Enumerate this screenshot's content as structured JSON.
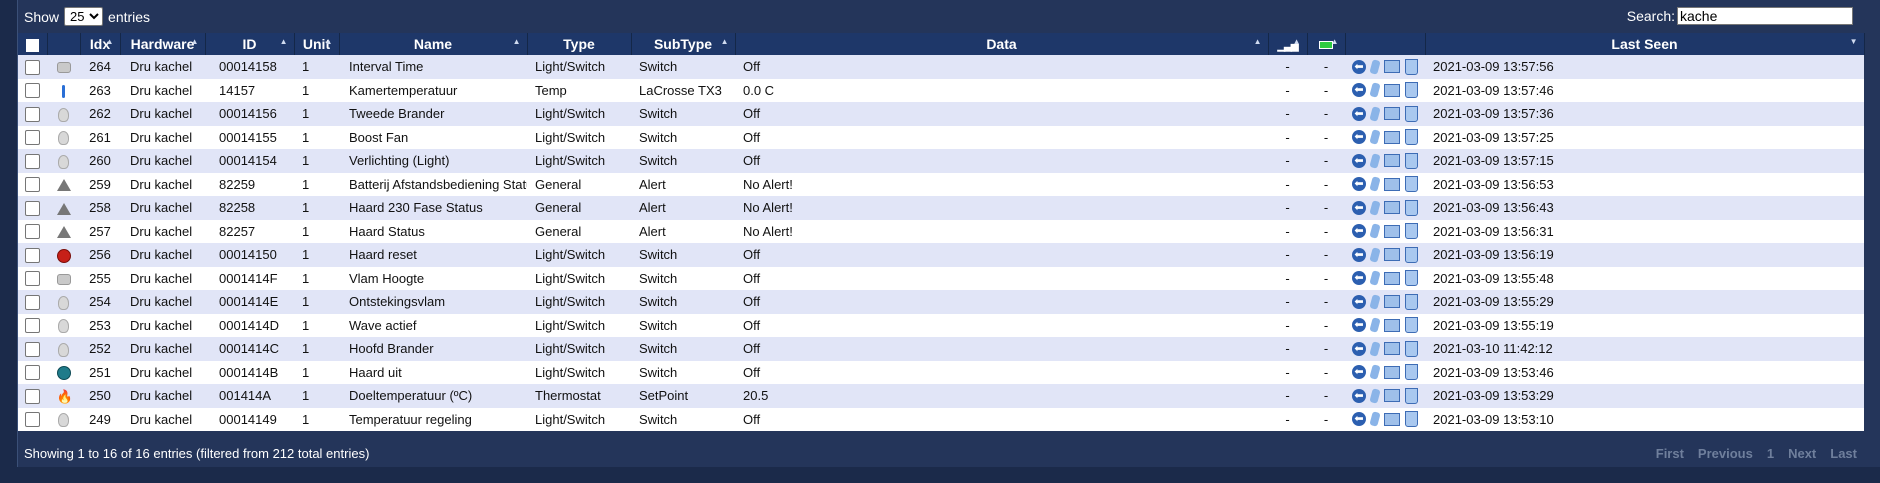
{
  "length_menu": {
    "show_label": "Show",
    "selected": "25",
    "entries_label": "entries"
  },
  "search": {
    "label": "Search:",
    "value": "kache"
  },
  "columns": [
    "Idx",
    "Hardware",
    "ID",
    "Unit",
    "Name",
    "Type",
    "SubType",
    "Data",
    "",
    "",
    "Last Seen"
  ],
  "rows": [
    {
      "icon": "stove-icon",
      "idx": "264",
      "hardware": "Dru kachel",
      "id": "00014158",
      "unit": "1",
      "name": "Interval Time",
      "type": "Light/Switch",
      "subtype": "Switch",
      "data": "Off",
      "signal": "-",
      "battery": "-",
      "last_seen": "2021-03-09 13:57:56"
    },
    {
      "icon": "thermometer-icon",
      "idx": "263",
      "hardware": "Dru kachel",
      "id": "14157",
      "unit": "1",
      "name": "Kamertemperatuur",
      "type": "Temp",
      "subtype": "LaCrosse TX3",
      "data": "0.0 C",
      "signal": "-",
      "battery": "-",
      "last_seen": "2021-03-09 13:57:46"
    },
    {
      "icon": "bulb-icon",
      "idx": "262",
      "hardware": "Dru kachel",
      "id": "00014156",
      "unit": "1",
      "name": "Tweede Brander",
      "type": "Light/Switch",
      "subtype": "Switch",
      "data": "Off",
      "signal": "-",
      "battery": "-",
      "last_seen": "2021-03-09 13:57:36"
    },
    {
      "icon": "bulb-icon",
      "idx": "261",
      "hardware": "Dru kachel",
      "id": "00014155",
      "unit": "1",
      "name": "Boost Fan",
      "type": "Light/Switch",
      "subtype": "Switch",
      "data": "Off",
      "signal": "-",
      "battery": "-",
      "last_seen": "2021-03-09 13:57:25"
    },
    {
      "icon": "bulb-icon",
      "idx": "260",
      "hardware": "Dru kachel",
      "id": "00014154",
      "unit": "1",
      "name": "Verlichting (Light)",
      "type": "Light/Switch",
      "subtype": "Switch",
      "data": "Off",
      "signal": "-",
      "battery": "-",
      "last_seen": "2021-03-09 13:57:15"
    },
    {
      "icon": "warning-icon",
      "idx": "259",
      "hardware": "Dru kachel",
      "id": "82259",
      "unit": "1",
      "name": "Batterij Afstandsbediening Status",
      "type": "General",
      "subtype": "Alert",
      "data": "No Alert!",
      "signal": "-",
      "battery": "-",
      "last_seen": "2021-03-09 13:56:53"
    },
    {
      "icon": "warning-icon",
      "idx": "258",
      "hardware": "Dru kachel",
      "id": "82258",
      "unit": "1",
      "name": "Haard 230 Fase Status",
      "type": "General",
      "subtype": "Alert",
      "data": "No Alert!",
      "signal": "-",
      "battery": "-",
      "last_seen": "2021-03-09 13:56:43"
    },
    {
      "icon": "warning-icon",
      "idx": "257",
      "hardware": "Dru kachel",
      "id": "82257",
      "unit": "1",
      "name": "Haard Status",
      "type": "General",
      "subtype": "Alert",
      "data": "No Alert!",
      "signal": "-",
      "battery": "-",
      "last_seen": "2021-03-09 13:56:31"
    },
    {
      "icon": "power-red-icon",
      "idx": "256",
      "hardware": "Dru kachel",
      "id": "00014150",
      "unit": "1",
      "name": "Haard reset",
      "type": "Light/Switch",
      "subtype": "Switch",
      "data": "Off",
      "signal": "-",
      "battery": "-",
      "last_seen": "2021-03-09 13:56:19"
    },
    {
      "icon": "stove-icon",
      "idx": "255",
      "hardware": "Dru kachel",
      "id": "0001414F",
      "unit": "1",
      "name": "Vlam Hoogte",
      "type": "Light/Switch",
      "subtype": "Switch",
      "data": "Off",
      "signal": "-",
      "battery": "-",
      "last_seen": "2021-03-09 13:55:48"
    },
    {
      "icon": "bulb-icon",
      "idx": "254",
      "hardware": "Dru kachel",
      "id": "0001414E",
      "unit": "1",
      "name": "Ontstekingsvlam",
      "type": "Light/Switch",
      "subtype": "Switch",
      "data": "Off",
      "signal": "-",
      "battery": "-",
      "last_seen": "2021-03-09 13:55:29"
    },
    {
      "icon": "bulb-icon",
      "idx": "253",
      "hardware": "Dru kachel",
      "id": "0001414D",
      "unit": "1",
      "name": "Wave actief",
      "type": "Light/Switch",
      "subtype": "Switch",
      "data": "Off",
      "signal": "-",
      "battery": "-",
      "last_seen": "2021-03-09 13:55:19"
    },
    {
      "icon": "bulb-icon",
      "idx": "252",
      "hardware": "Dru kachel",
      "id": "0001414C",
      "unit": "1",
      "name": "Hoofd Brander",
      "type": "Light/Switch",
      "subtype": "Switch",
      "data": "Off",
      "signal": "-",
      "battery": "-",
      "last_seen": "2021-03-10 11:42:12"
    },
    {
      "icon": "power-teal-icon",
      "idx": "251",
      "hardware": "Dru kachel",
      "id": "0001414B",
      "unit": "1",
      "name": "Haard uit",
      "type": "Light/Switch",
      "subtype": "Switch",
      "data": "Off",
      "signal": "-",
      "battery": "-",
      "last_seen": "2021-03-09 13:53:46"
    },
    {
      "icon": "flame-icon",
      "idx": "250",
      "hardware": "Dru kachel",
      "id": "001414A",
      "unit": "1",
      "name": "Doeltemperatuur (ºC)",
      "type": "Thermostat",
      "subtype": "SetPoint",
      "data": "20.5",
      "signal": "-",
      "battery": "-",
      "last_seen": "2021-03-09 13:53:29"
    },
    {
      "icon": "bulb-icon",
      "idx": "249",
      "hardware": "Dru kachel",
      "id": "00014149",
      "unit": "1",
      "name": "Temperatuur regeling",
      "type": "Light/Switch",
      "subtype": "Switch",
      "data": "Off",
      "signal": "-",
      "battery": "-",
      "last_seen": "2021-03-09 13:53:10"
    }
  ],
  "footer": {
    "info": "Showing 1 to 16 of 16 entries (filtered from 212 total entries)",
    "first": "First",
    "previous": "Previous",
    "page": "1",
    "next": "Next",
    "last": "Last"
  },
  "colors": {
    "header": "#1e3769",
    "row_alt": "#e1e5f7",
    "background": "#24355a"
  }
}
